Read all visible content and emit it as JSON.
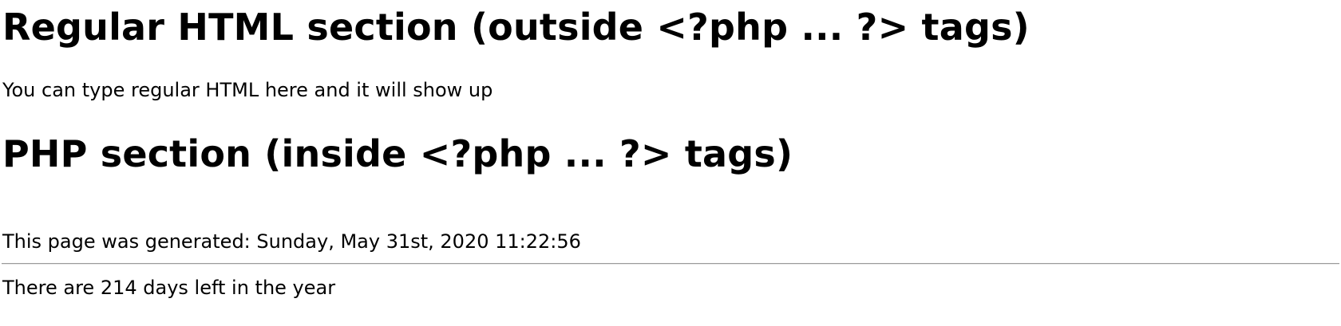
{
  "regular_section": {
    "heading": "Regular HTML section (outside <?php ... ?> tags)",
    "text": "You can type regular HTML here and it will show up"
  },
  "php_section": {
    "heading": "PHP section (inside <?php ... ?> tags)",
    "generated_text": "This page was generated: Sunday, May 31st, 2020 11:22:56",
    "days_left_text": "There are 214 days left in the year"
  }
}
